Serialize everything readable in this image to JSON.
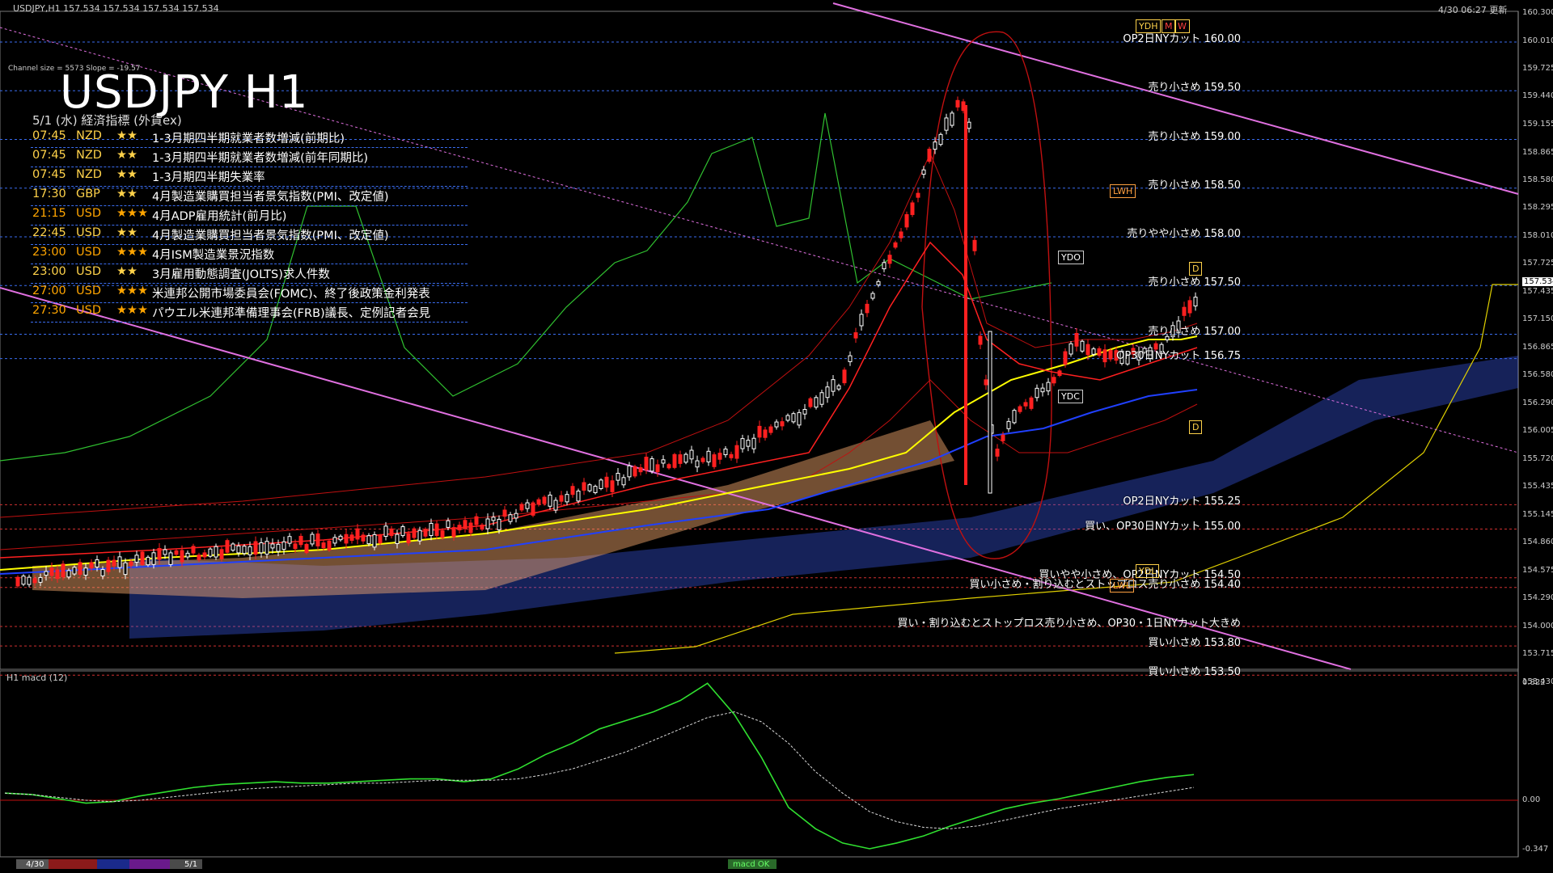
{
  "window": {
    "symbol_header": "USDJPY,H1  157.534 157.534 157.534 157.534",
    "datetime_header": "4/30 06:27 更新",
    "channel_info": "Channel size = 5573 Slope = -19.57"
  },
  "title": "USDJPY H1",
  "calendar": {
    "subtitle": "5/1 (水) 経済指標 (外貨ex)",
    "rows": [
      {
        "time": "07:45",
        "cur": "NZD",
        "stars": "★★",
        "event": "1-3月期四半期就業者数増減(前期比)",
        "color": "#ffd24a"
      },
      {
        "time": "07:45",
        "cur": "NZD",
        "stars": "★★",
        "event": "1-3月期四半期就業者数増減(前年同期比)",
        "color": "#ffd24a"
      },
      {
        "time": "07:45",
        "cur": "NZD",
        "stars": "★★",
        "event": "1-3月期四半期失業率",
        "color": "#ffd24a"
      },
      {
        "time": "17:30",
        "cur": "GBP",
        "stars": "★★",
        "event": "4月製造業購買担当者景気指数(PMI、改定値)",
        "color": "#ffd24a"
      },
      {
        "time": "21:15",
        "cur": "USD",
        "stars": "★★★",
        "event": "4月ADP雇用統計(前月比)",
        "color": "#ffa500"
      },
      {
        "time": "22:45",
        "cur": "USD",
        "stars": "★★",
        "event": "4月製造業購買担当者景気指数(PMI、改定値)",
        "color": "#ffd24a"
      },
      {
        "time": "23:00",
        "cur": "USD",
        "stars": "★★★",
        "event": "4月ISM製造業景況指数",
        "color": "#ffa500"
      },
      {
        "time": "23:00",
        "cur": "USD",
        "stars": "★★",
        "event": "3月雇用動態調査(JOLTS)求人件数",
        "color": "#ffd24a"
      },
      {
        "time": "27:00",
        "cur": "USD",
        "stars": "★★★",
        "event": "米連邦公開市場委員会(FOMC)、終了後政策金利発表",
        "color": "#ffa500"
      },
      {
        "time": "27:30",
        "cur": "USD",
        "stars": "★★★",
        "event": "パウエル米連邦準備理事会(FRB)議長、定例記者会見",
        "color": "#ffa500"
      }
    ]
  },
  "price_axis": [
    "160.300",
    "160.010",
    "159.725",
    "159.440",
    "159.155",
    "158.865",
    "158.580",
    "158.295",
    "158.010",
    "157.725",
    "157.534",
    "157.435",
    "157.150",
    "156.865",
    "156.580",
    "156.290",
    "156.005",
    "155.720",
    "155.435",
    "155.145",
    "154.860",
    "154.575",
    "154.290",
    "154.000",
    "153.715",
    "153.430"
  ],
  "current_price": "157.534",
  "levels": [
    {
      "text": "OP2日NYカット 160.00",
      "price": 160.0,
      "color": "#3a6df0"
    },
    {
      "text": "売り小さめ 159.50",
      "price": 159.5,
      "color": "#3a6df0"
    },
    {
      "text": "売り小さめ 159.00",
      "price": 159.0,
      "color": "#3a6df0"
    },
    {
      "text": "売り小さめ 158.50",
      "price": 158.5,
      "color": "#3a6df0"
    },
    {
      "text": "売りやや小さめ 158.00",
      "price": 158.0,
      "color": "#3a6df0"
    },
    {
      "text": "売り小さめ 157.50",
      "price": 157.5,
      "color": "#3a6df0"
    },
    {
      "text": "売り小さめ 157.00",
      "price": 157.0,
      "color": "#3a6df0"
    },
    {
      "text": "OP30日NYカット 156.75",
      "price": 156.75,
      "color": "#3a6df0"
    },
    {
      "text": "OP2日NYカット 155.25",
      "price": 155.25,
      "color": "#d03030"
    },
    {
      "text": "買い、OP30日NYカット 155.00",
      "price": 155.0,
      "color": "#d03030"
    },
    {
      "text": "買いやや小さめ、OP2日NYカット 154.50",
      "price": 154.5,
      "color": "#d03030"
    },
    {
      "text": "買い小さめ・割り込むとストップロス売り小さめ 154.40",
      "price": 154.4,
      "color": "#d03030"
    },
    {
      "text": "買い・割り込むとストップロス売り小さめ、OP30・1日NYカット大きめ",
      "price": 154.0,
      "color": "#d03030"
    },
    {
      "text": "買い小さめ 153.80",
      "price": 153.8,
      "color": "#d03030"
    },
    {
      "text": "買い小さめ 153.50",
      "price": 153.5,
      "color": "#d03030"
    }
  ],
  "tags": {
    "ydh": "YDH",
    "m": "M",
    "w": "W",
    "lwh": "LWH",
    "ydo": "YDO",
    "ydc": "YDC",
    "ydl": "YDL",
    "lwl": "LWL",
    "d": "D"
  },
  "macd": {
    "label": "H1  macd (12)",
    "axis": [
      "0.822",
      "0.00",
      "-0.347"
    ],
    "series": {
      "macd": [
        0.05,
        0.04,
        0.01,
        -0.02,
        -0.01,
        0.03,
        0.06,
        0.09,
        0.11,
        0.12,
        0.13,
        0.12,
        0.12,
        0.13,
        0.14,
        0.15,
        0.15,
        0.13,
        0.15,
        0.22,
        0.32,
        0.4,
        0.5,
        0.56,
        0.62,
        0.7,
        0.82,
        0.6,
        0.3,
        -0.05,
        -0.2,
        -0.3,
        -0.34,
        -0.3,
        -0.25,
        -0.18,
        -0.12,
        -0.06,
        -0.02,
        0.01,
        0.05,
        0.09,
        0.13,
        0.16,
        0.18
      ],
      "signal": [
        0.05,
        0.04,
        0.02,
        0.0,
        -0.01,
        0.0,
        0.02,
        0.04,
        0.06,
        0.08,
        0.09,
        0.1,
        0.11,
        0.12,
        0.12,
        0.13,
        0.14,
        0.14,
        0.14,
        0.15,
        0.18,
        0.22,
        0.28,
        0.34,
        0.42,
        0.5,
        0.58,
        0.62,
        0.55,
        0.4,
        0.2,
        0.05,
        -0.08,
        -0.15,
        -0.19,
        -0.2,
        -0.18,
        -0.14,
        -0.1,
        -0.06,
        -0.03,
        0.0,
        0.03,
        0.06,
        0.09
      ]
    }
  },
  "time_axis": {
    "a": "4/30",
    "b": "5/1",
    "c": "macd OK"
  },
  "colors": {
    "bull": "#ffffff",
    "bear": "#ff2020",
    "ma_fast": "#ff2020",
    "ma_mid": "#ffff00",
    "ma_slow": "#2040ff",
    "kumo_bull": "#ffb070",
    "kumo_bear": "#4060ff",
    "chikou": "#30c030",
    "channel": "#e070e0"
  }
}
